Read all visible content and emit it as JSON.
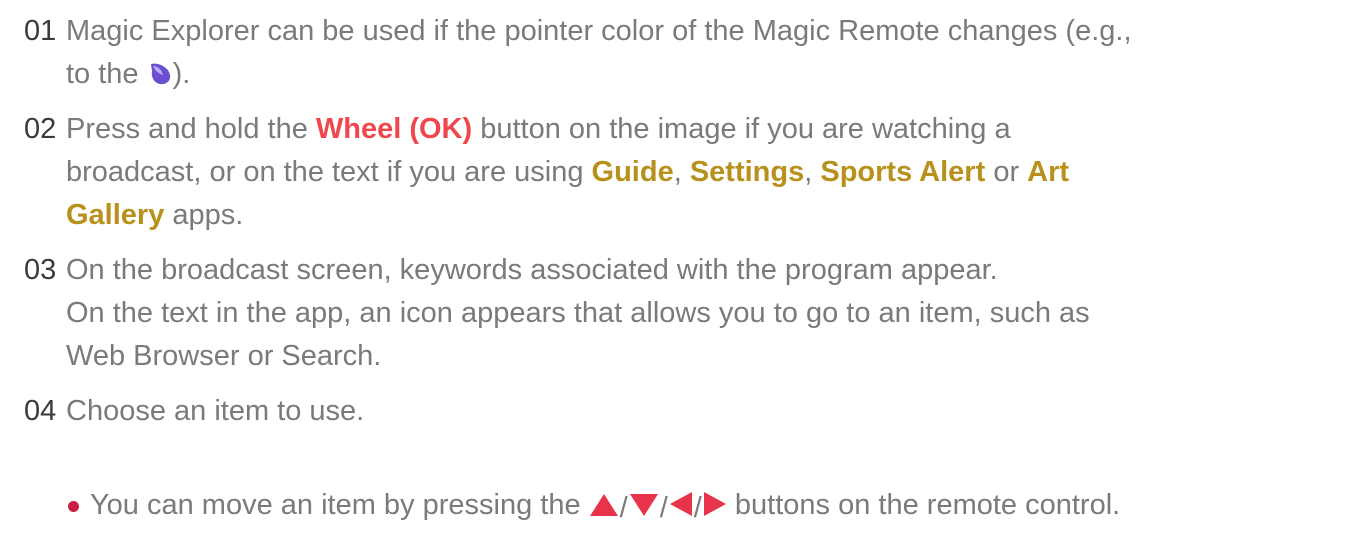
{
  "steps": [
    {
      "num": "01",
      "text_a": "Magic Explorer can be used if the pointer color of the Magic Remote changes (e.g.,",
      "text_b": "to the ",
      "text_c": ")."
    },
    {
      "num": "02",
      "p1": "Press and hold the ",
      "wheel": "Wheel (OK)",
      "p2": " button on the image if you are watching a",
      "p3": "broadcast, or on the text if you are using ",
      "guide": "Guide",
      "comma1": ", ",
      "settings": "Settings",
      "comma2": ", ",
      "sports": "Sports Alert",
      "or": " or ",
      "art": "Art",
      "gallery": "Gallery",
      "p4": " apps."
    },
    {
      "num": "03",
      "line1": "On the broadcast screen, keywords associated with the program appear.",
      "line2": "On the text in the app, an icon appears that allows you to go to an item, such as",
      "line3": "Web Browser or Search."
    },
    {
      "num": "04",
      "line1": "Choose an item to use."
    }
  ],
  "bullet": {
    "before": "You can move an item by pressing the ",
    "after": " buttons on the remote control."
  },
  "icons": {
    "pointer": "magic-pointer-icon",
    "up": "up-arrow-icon",
    "down": "down-arrow-icon",
    "left": "left-arrow-icon",
    "right": "right-arrow-icon"
  },
  "colors": {
    "number": "#3a3a3a",
    "body_text": "#7a7a7a",
    "wheel_highlight": "#f0474e",
    "menu_highlight": "#b8901c",
    "arrow": "#e8344a",
    "bullet_dot": "#cc1f45",
    "pointer": "#6a4fd1"
  }
}
